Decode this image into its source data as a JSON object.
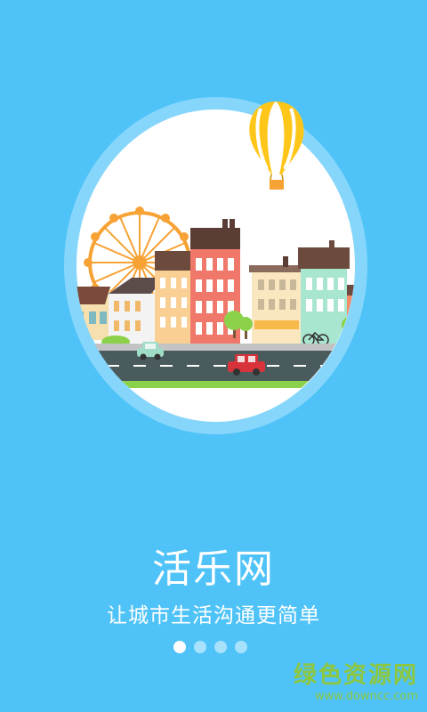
{
  "app": {
    "title": "活乐网",
    "subtitle": "让城市生活沟通更简单"
  },
  "pager": {
    "total": 4,
    "active_index": 0
  },
  "watermark": {
    "brand": "绿色资源网",
    "url": "www.downcc.com"
  },
  "colors": {
    "background": "#4fc3f7",
    "accent": "#ffffff"
  }
}
